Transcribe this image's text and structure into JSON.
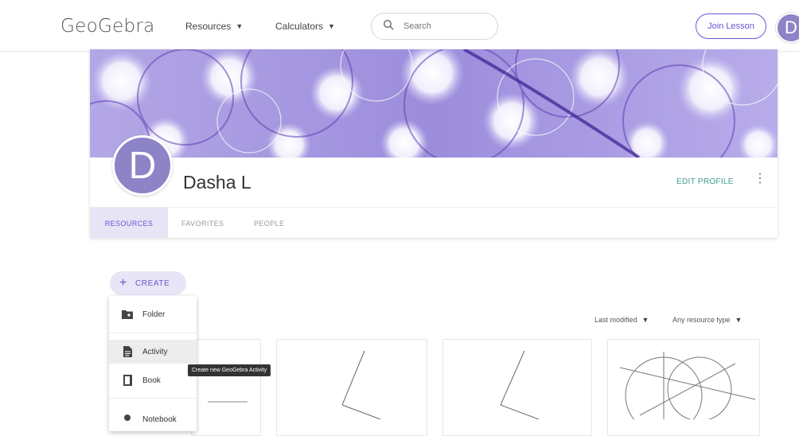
{
  "header": {
    "logo": "GeoGebra",
    "nav": [
      {
        "label": "Resources"
      },
      {
        "label": "Calculators"
      }
    ],
    "search": {
      "placeholder": "Search"
    },
    "join_lesson": "Join Lesson",
    "avatar_letter": "D"
  },
  "profile": {
    "avatar_letter": "D",
    "name": "Dasha L",
    "edit_label": "EDIT PROFILE",
    "more_icon": "vertical-dots-icon",
    "tabs": [
      {
        "label": "RESOURCES",
        "active": true
      },
      {
        "label": "FAVORITES",
        "active": false
      },
      {
        "label": "PEOPLE",
        "active": false
      }
    ]
  },
  "create": {
    "label": "CREATE",
    "icon": "plus-icon"
  },
  "create_menu": {
    "items": [
      {
        "label": "Folder",
        "icon": "new-folder-icon"
      },
      {
        "label": "Activity",
        "icon": "activity-icon",
        "hovered": true
      },
      {
        "label": "Book",
        "icon": "book-icon"
      },
      {
        "label": "Notebook",
        "icon": "notebook-icon"
      }
    ],
    "tooltip": "Create new GeoGebra Activity"
  },
  "filters": {
    "sort": "Last modified",
    "type": "Any resource type"
  },
  "colors": {
    "accent": "#6557d2",
    "teal": "#3b9c8f",
    "avatar": "#8d84c7",
    "active_tab_bg": "#e7e4f6"
  }
}
